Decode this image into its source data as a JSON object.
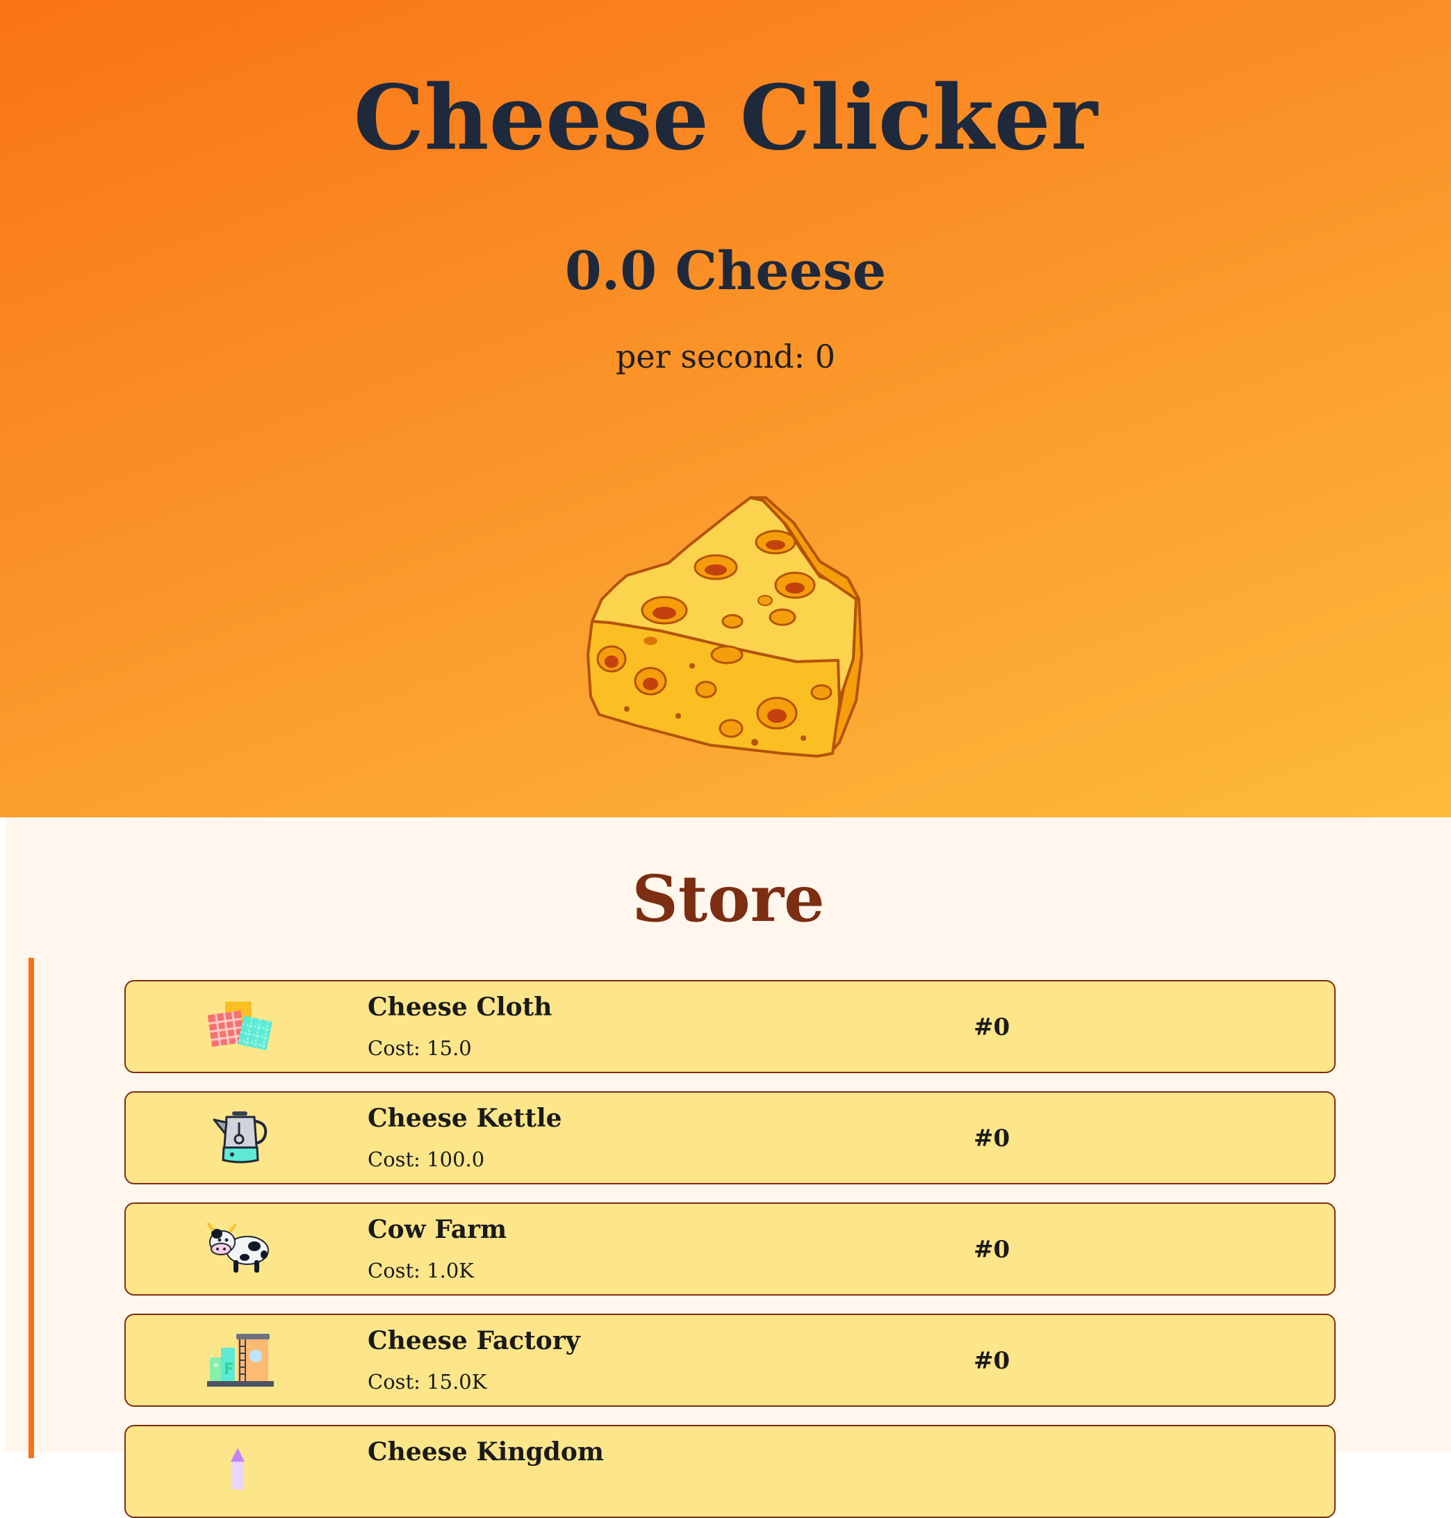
{
  "header": {
    "title": "Cheese Clicker",
    "cheese_count": "0.0 Cheese",
    "per_second": "per second: 0"
  },
  "clicker": {
    "icon": "cheese-wedge-icon"
  },
  "store": {
    "title": "Store",
    "items": [
      {
        "name": "Cheese Cloth",
        "cost": "Cost: 15.0",
        "owned": "#0",
        "icon": "cheese-cloth-icon"
      },
      {
        "name": "Cheese Kettle",
        "cost": "Cost: 100.0",
        "owned": "#0",
        "icon": "kettle-icon"
      },
      {
        "name": "Cow Farm",
        "cost": "Cost: 1.0K",
        "owned": "#0",
        "icon": "cow-icon"
      },
      {
        "name": "Cheese Factory",
        "cost": "Cost: 15.0K",
        "owned": "#0",
        "icon": "factory-icon"
      },
      {
        "name": "Cheese Kingdom",
        "cost": "",
        "owned": "",
        "icon": "castle-icon"
      }
    ]
  },
  "colors": {
    "gradient_start": "#f97316",
    "gradient_end": "#fdbb3b",
    "title_text": "#1e293b",
    "store_bg": "#fff7ed",
    "store_title": "#7c2d12",
    "item_bg": "#fde68a",
    "item_border": "#7c2d12"
  }
}
